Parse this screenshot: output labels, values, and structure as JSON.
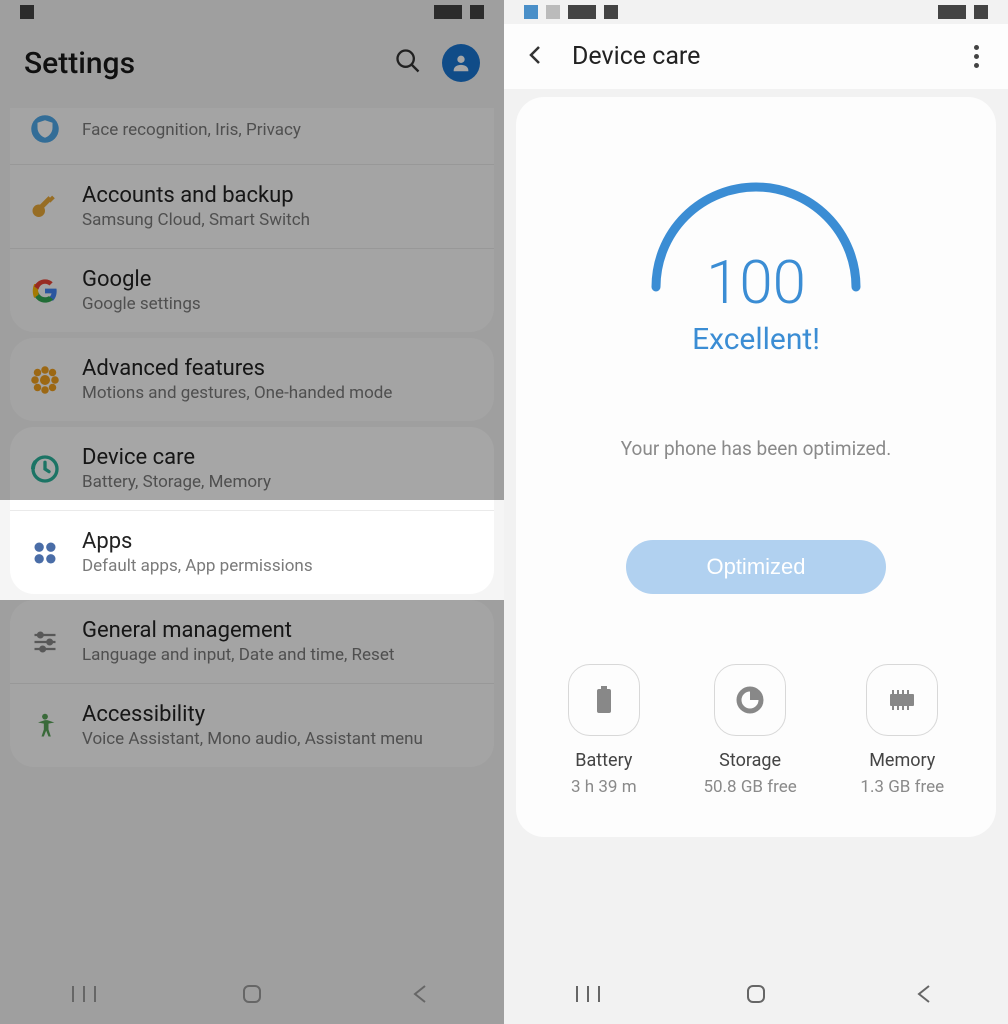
{
  "left": {
    "header_title": "Settings",
    "items": [
      {
        "title": "",
        "subtitle": "Face recognition, Iris, Privacy"
      },
      {
        "title": "Accounts and backup",
        "subtitle": "Samsung Cloud, Smart Switch"
      },
      {
        "title": "Google",
        "subtitle": "Google settings"
      },
      {
        "title": "Advanced features",
        "subtitle": "Motions and gestures, One-handed mode"
      },
      {
        "title": "Device care",
        "subtitle": "Battery, Storage, Memory"
      },
      {
        "title": "Apps",
        "subtitle": "Default apps, App permissions"
      },
      {
        "title": "General management",
        "subtitle": "Language and input, Date and time, Reset"
      },
      {
        "title": "Accessibility",
        "subtitle": "Voice Assistant, Mono audio, Assistant menu"
      }
    ]
  },
  "right": {
    "header_title": "Device care",
    "score": "100",
    "score_label": "Excellent!",
    "optimized_text": "Your phone has been optimized.",
    "button_label": "Optimized",
    "stats": [
      {
        "label": "Battery",
        "value": "3 h 39 m"
      },
      {
        "label": "Storage",
        "value": "50.8 GB free"
      },
      {
        "label": "Memory",
        "value": "1.3 GB free"
      }
    ]
  },
  "colors": {
    "accent": "#3b8dd4",
    "button_bg": "#b1d1f0"
  }
}
